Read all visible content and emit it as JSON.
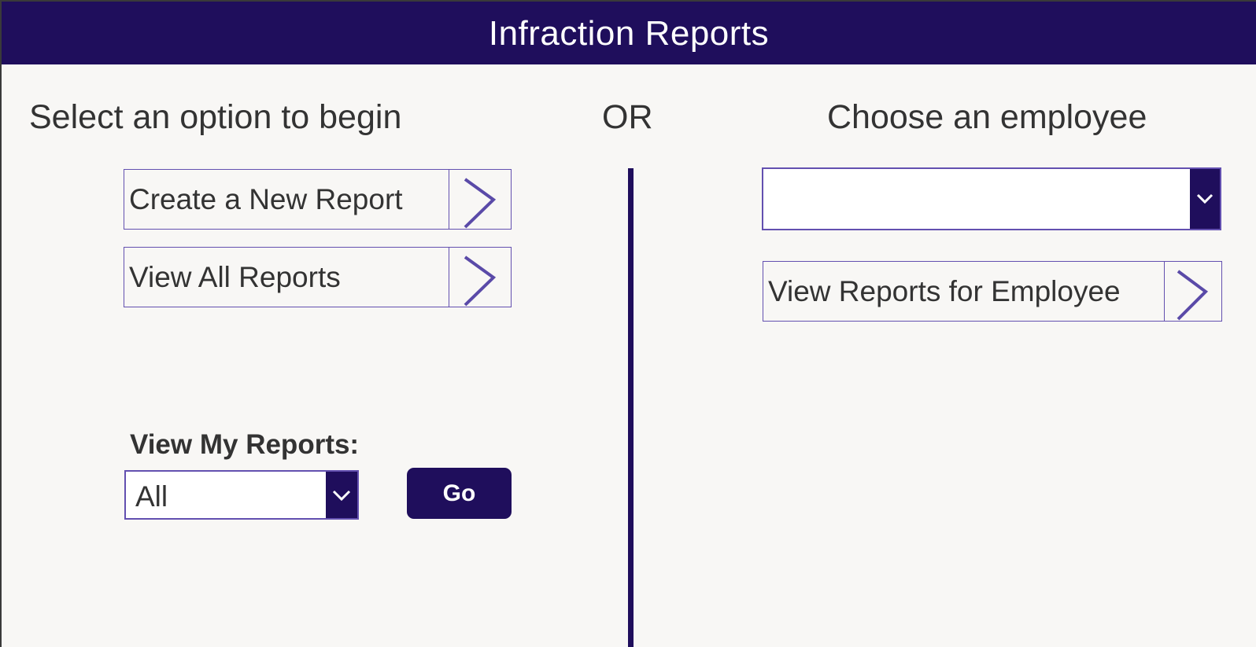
{
  "header": {
    "title": "Infraction Reports"
  },
  "left_panel": {
    "heading": "Select an option to begin",
    "buttons": [
      {
        "label": "Create a New Report",
        "icon": "chevron-right-icon"
      },
      {
        "label": "View All Reports",
        "icon": "chevron-right-icon"
      }
    ],
    "my_reports": {
      "label": "View My Reports:",
      "selected": "All",
      "icon": "chevron-down-icon",
      "go_label": "Go"
    }
  },
  "separator": {
    "text": "OR"
  },
  "right_panel": {
    "heading": "Choose an employee",
    "employee_dropdown": {
      "selected": "",
      "icon": "chevron-down-icon"
    },
    "view_button": {
      "label": "View Reports for Employee",
      "icon": "chevron-right-icon"
    }
  },
  "colors": {
    "header_bg": "#1f0e5c",
    "accent_border": "#6350b0",
    "page_bg": "#f8f7f5",
    "text": "#333333"
  }
}
